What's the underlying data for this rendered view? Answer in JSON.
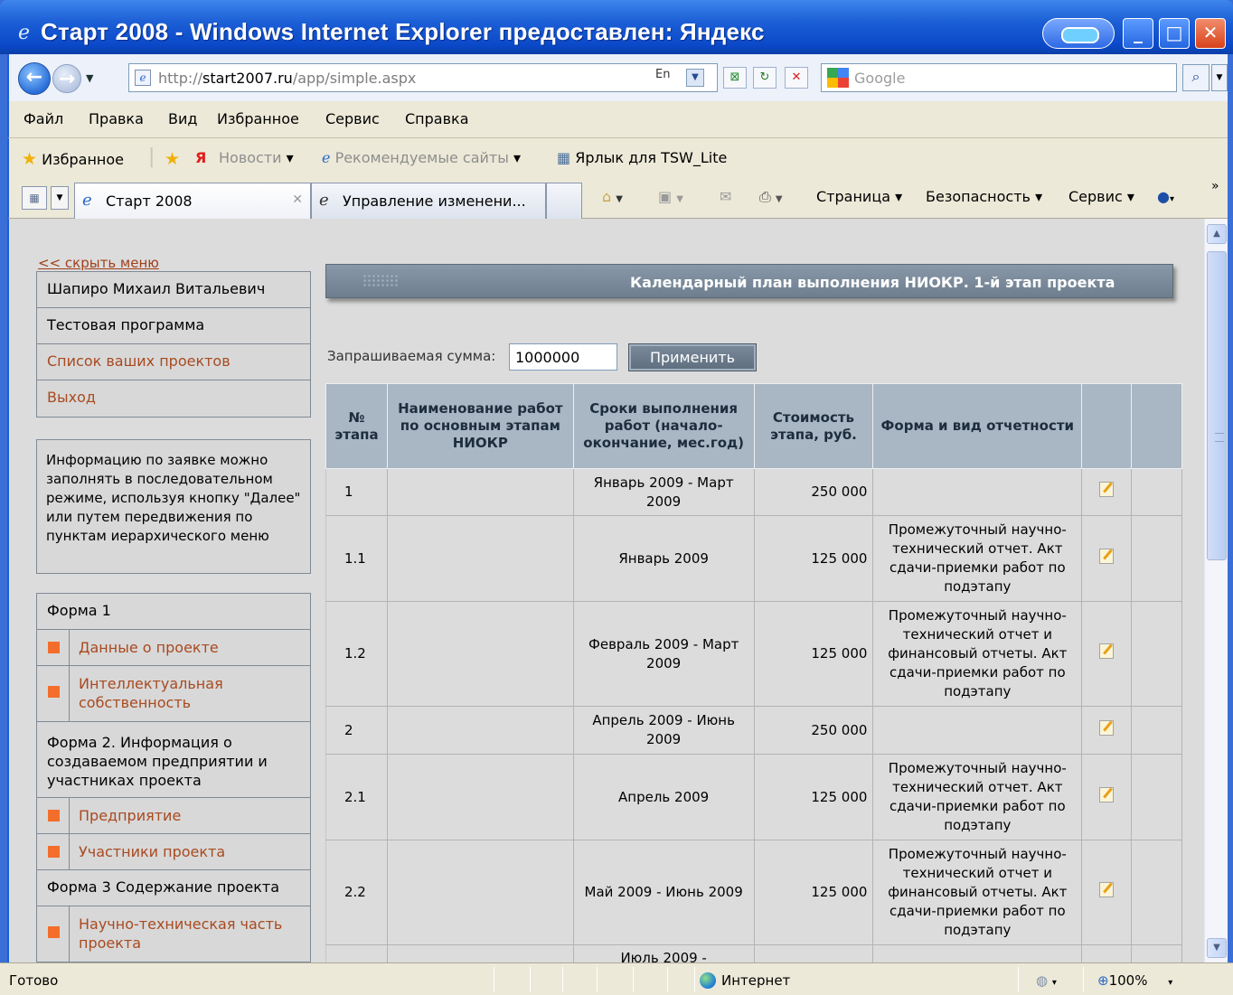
{
  "window": {
    "title": "Старт 2008 - Windows Internet Explorer предоставлен: Яндекс"
  },
  "address": {
    "url_prefix": "http://",
    "url_host": "start2007.ru",
    "url_path": "/app/simple.aspx",
    "lang": "En",
    "search_placeholder": "Google"
  },
  "menu": [
    "Файл",
    "Правка",
    "Вид",
    "Избранное",
    "Сервис",
    "Справка"
  ],
  "favorites": {
    "favorites_label": "Избранное",
    "news": "Новости",
    "recommended": "Рекомендуемые сайты",
    "shortcut": "Ярлык для TSW_Lite"
  },
  "tabs": {
    "active": "Старт 2008",
    "inactive": "Управление изменени..."
  },
  "commandbar": {
    "page": "Страница",
    "security": "Безопасность",
    "service": "Сервис"
  },
  "sidebar": {
    "hide_menu": "<< скрыть меню",
    "user": "Шапиро Михаил Витальевич",
    "program": "Тестовая программа",
    "projects": "Список ваших проектов",
    "logout": "Выход",
    "info": "Информацию по заявке можно заполнять в последовательном режиме, используя кнопку \"Далее\" или путем передвижения по пунктам иерархического меню",
    "form1": "Форма 1",
    "form1_items": [
      "Данные о проекте",
      "Интеллектуальная собственность"
    ],
    "form2": "Форма 2. Информация о создаваемом предприятии и участниках проекта",
    "form2_items": [
      "Предприятие",
      "Участники проекта"
    ],
    "form3": "Форма 3 Содержание проекта",
    "form3_items": [
      "Научно-техническая часть проекта"
    ]
  },
  "main": {
    "header": "Календарный план выполнения НИОКР. 1-й этап проекта",
    "sum_label": "Запрашиваемая сумма:",
    "sum_value": "1000000",
    "apply_label": "Применить",
    "columns": [
      "№ этапа",
      "Наименование работ по основным этапам НИОКР",
      "Сроки выполнения работ (начало-окончание, мес.год)",
      "Стоимость этапа, руб.",
      "Форма и вид отчетности"
    ],
    "rows": [
      {
        "num": "1",
        "name": "",
        "dates": "Январь 2009 - Март 2009",
        "cost": "250 000",
        "report": ""
      },
      {
        "num": "1.1",
        "name": "",
        "dates": "Январь 2009",
        "cost": "125 000",
        "report": "Промежуточный научно-технический отчет. Акт сдачи-приемки работ по подэтапу"
      },
      {
        "num": "1.2",
        "name": "",
        "dates": "Февраль 2009 - Март 2009",
        "cost": "125 000",
        "report": "Промежуточный научно-технический отчет и финансовый отчеты. Акт сдачи-приемки работ по подэтапу"
      },
      {
        "num": "2",
        "name": "",
        "dates": "Апрель 2009 - Июнь 2009",
        "cost": "250 000",
        "report": ""
      },
      {
        "num": "2.1",
        "name": "",
        "dates": "Апрель 2009",
        "cost": "125 000",
        "report": "Промежуточный научно-технический отчет. Акт сдачи-приемки работ по подэтапу"
      },
      {
        "num": "2.2",
        "name": "",
        "dates": "Май 2009 - Июнь 2009",
        "cost": "125 000",
        "report": "Промежуточный научно-технический отчет и финансовый отчеты. Акт сдачи-приемки работ по подэтапу"
      },
      {
        "num": "",
        "name": "",
        "dates": "Июль 2009 -",
        "cost": "",
        "report": ""
      }
    ]
  },
  "status": {
    "ready": "Готово",
    "zone": "Интернет",
    "zoom": "100%"
  }
}
